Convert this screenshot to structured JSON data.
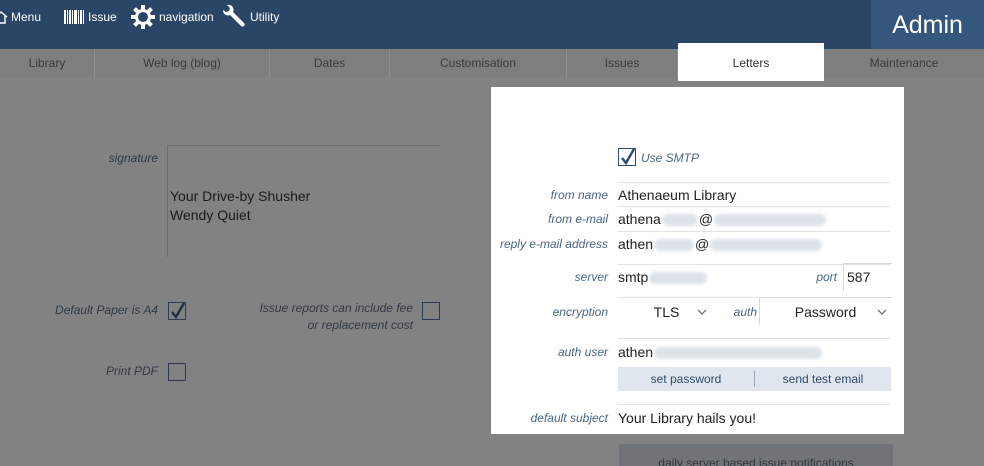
{
  "topnav": {
    "menu": "Menu",
    "issue": "Issue",
    "navigation": "navigation",
    "utility": "Utility",
    "admin": "Admin"
  },
  "tabs": [
    "Library",
    "Web log (blog)",
    "Dates",
    "Customisation",
    "Issues",
    "Letters",
    "Maintenance"
  ],
  "left": {
    "signature_label": "signature",
    "signature_line1": "Your Drive-by Shusher",
    "signature_line2": "Wendy Quiet",
    "default_paper_label": "Default Paper is A4",
    "default_paper_checked": true,
    "issue_reports_label_line1": "Issue reports can include fee",
    "issue_reports_label_line2": "or replacement cost",
    "issue_reports_checked": false,
    "print_pdf_label": "Print PDF",
    "print_pdf_checked": false
  },
  "panel": {
    "use_smtp_label": "Use SMTP",
    "use_smtp_checked": true,
    "from_name_label": "from name",
    "from_name_value": "Athenaeum Library",
    "from_email_label": "from e-mail",
    "from_email_prefix": "athena",
    "from_email_at": "@",
    "reply_email_label": "reply e-mail address",
    "reply_email_prefix": "athen",
    "reply_email_at": "@",
    "server_label": "server",
    "server_prefix": "smtp",
    "port_label": "port",
    "port_value": "587",
    "encryption_label": "encryption",
    "encryption_value": "TLS",
    "auth_label": "auth",
    "auth_value": "Password",
    "auth_user_label": "auth user",
    "auth_user_prefix": "athen",
    "set_password_button": "set password",
    "send_test_email_button": "send test email",
    "default_subject_label": "default subject",
    "default_subject_value": "Your Library hails you!"
  },
  "footer": {
    "daily_button": "daily server based issue notifications"
  },
  "colors": {
    "topbar": "#2a4566",
    "admin_tab": "#36577c",
    "overlay_gray": "#828282",
    "label_blue": "#4a6585",
    "button_bar": "#dfe6ee"
  }
}
